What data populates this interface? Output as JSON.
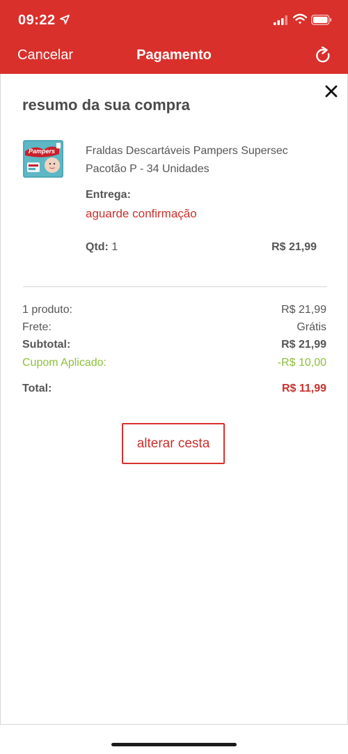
{
  "status_bar": {
    "time": "09:22"
  },
  "nav": {
    "cancel_label": "Cancelar",
    "title": "Pagamento"
  },
  "summary": {
    "title": "resumo da sua compra",
    "product": {
      "name": "Fraldas Descartáveis Pampers Supersec Pacotão P - 34 Unidades",
      "brand_logo_text": "Pampers",
      "delivery_label": "Entrega:",
      "delivery_status": "aguarde confirmação",
      "qty_label": "Qtd:",
      "qty_value": "1",
      "price": "R$ 21,99"
    },
    "rows": {
      "products_label": "1 produto:",
      "products_value": "R$ 21,99",
      "shipping_label": "Frete:",
      "shipping_value": "Grátis",
      "subtotal_label": "Subtotal:",
      "subtotal_value": "R$ 21,99",
      "coupon_label": "Cupom Aplicado:",
      "coupon_value": "-R$ 10,00",
      "total_label": "Total:",
      "total_value": "R$ 11,99"
    },
    "change_cart_label": "alterar cesta"
  },
  "colors": {
    "header": "#d9302c",
    "accent_red": "#c9302c",
    "coupon_green": "#8cbf3a",
    "text": "#555555"
  },
  "icons": [
    "location-arrow-icon",
    "signal-icon",
    "wifi-icon",
    "battery-icon",
    "refresh-icon",
    "close-icon",
    "product-image"
  ]
}
